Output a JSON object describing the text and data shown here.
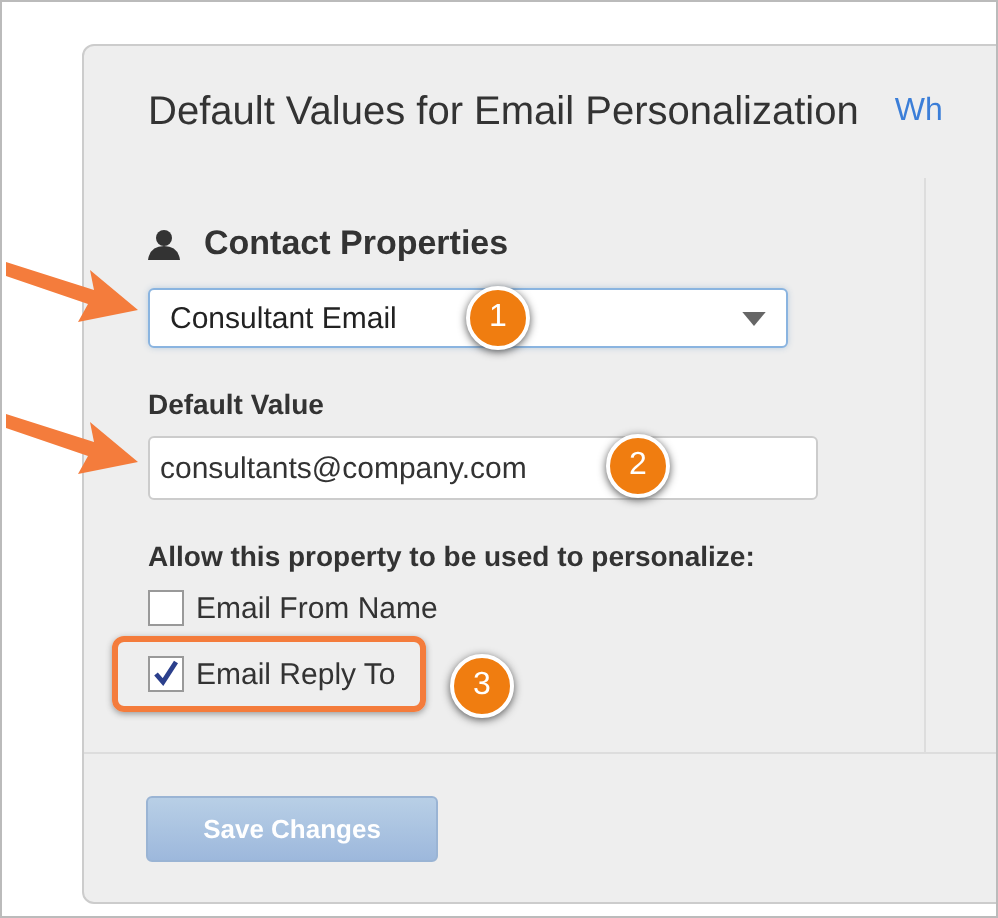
{
  "title": "Default Values for Email Personalization",
  "help_link": "Wh",
  "section": {
    "heading": "Contact Properties"
  },
  "property_select": {
    "value": "Consultant Email"
  },
  "default_value": {
    "label": "Default Value",
    "value": "consultants@company.com"
  },
  "allow": {
    "label": "Allow this property to be used to personalize:",
    "options": [
      {
        "label": "Email From Name",
        "checked": false,
        "highlighted": false
      },
      {
        "label": "Email Reply To",
        "checked": true,
        "highlighted": true
      }
    ]
  },
  "save_button": {
    "label": "Save Changes",
    "disabled": true
  },
  "annotations": [
    {
      "number": "1",
      "arrow": true
    },
    {
      "number": "2",
      "arrow": true
    },
    {
      "number": "3",
      "arrow": false
    }
  ]
}
